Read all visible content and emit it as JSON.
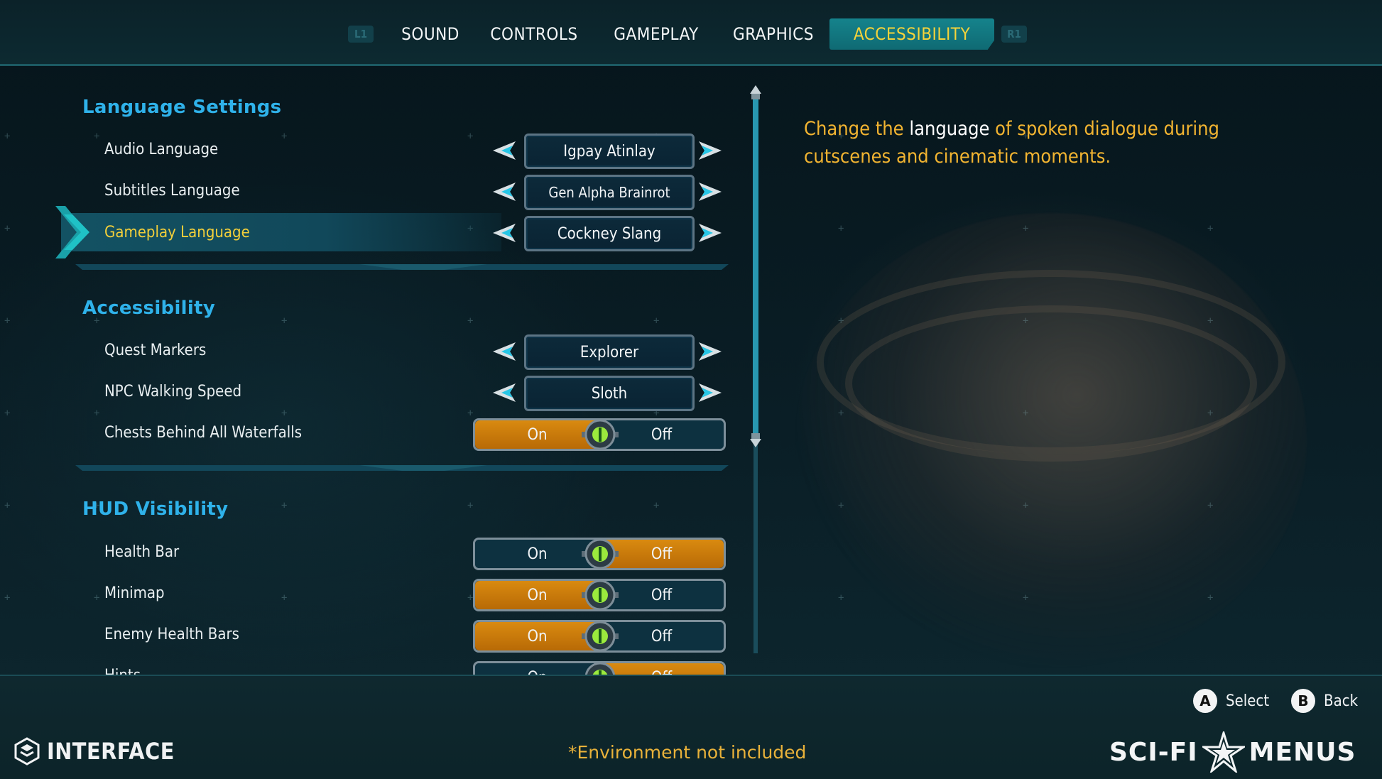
{
  "tabs": {
    "left_shoulder": "L1",
    "right_shoulder": "R1",
    "items": [
      "SOUND",
      "CONTROLS",
      "GAMEPLAY",
      "GRAPHICS",
      "ACCESSIBILITY"
    ],
    "active": "ACCESSIBILITY"
  },
  "sections": {
    "language": {
      "title": "Language Settings",
      "rows": [
        {
          "label": "Audio Language",
          "value": "Igpay Atinlay"
        },
        {
          "label": "Subtitles Language",
          "value": "Gen Alpha Brainrot"
        },
        {
          "label": "Gameplay Language",
          "value": "Cockney Slang",
          "selected": true
        }
      ]
    },
    "accessibility": {
      "title": "Accessibility",
      "rows": [
        {
          "label": "Quest Markers",
          "value": "Explorer"
        },
        {
          "label": "NPC Walking Speed",
          "value": "Sloth"
        },
        {
          "label": "Chests Behind All Waterfalls",
          "on": "On",
          "off": "Off",
          "state": "on"
        }
      ]
    },
    "hud": {
      "title": "HUD Visibility",
      "rows": [
        {
          "label": "Health Bar",
          "on": "On",
          "off": "Off",
          "state": "off"
        },
        {
          "label": "Minimap",
          "on": "On",
          "off": "Off",
          "state": "on"
        },
        {
          "label": "Enemy Health Bars",
          "on": "On",
          "off": "Off",
          "state": "on"
        },
        {
          "label": "Hints",
          "on": "On",
          "off": "Off",
          "state": "off"
        }
      ]
    }
  },
  "description": {
    "prefix": "Change the ",
    "highlight": "language",
    "suffix": " of spoken dialogue during cutscenes and cinematic moments."
  },
  "footer": {
    "select_button": "A",
    "select_label": "Select",
    "back_button": "B",
    "back_label": "Back",
    "brand": "INTERFACE",
    "note": "*Environment not included",
    "logo_left": "SCI-FI",
    "logo_right": "MENUS"
  },
  "colors": {
    "accent_cyan": "#2fb2ea",
    "selected_text": "#f3cf3a",
    "toggle_on": "#d98a10",
    "description": "#f2b431"
  }
}
